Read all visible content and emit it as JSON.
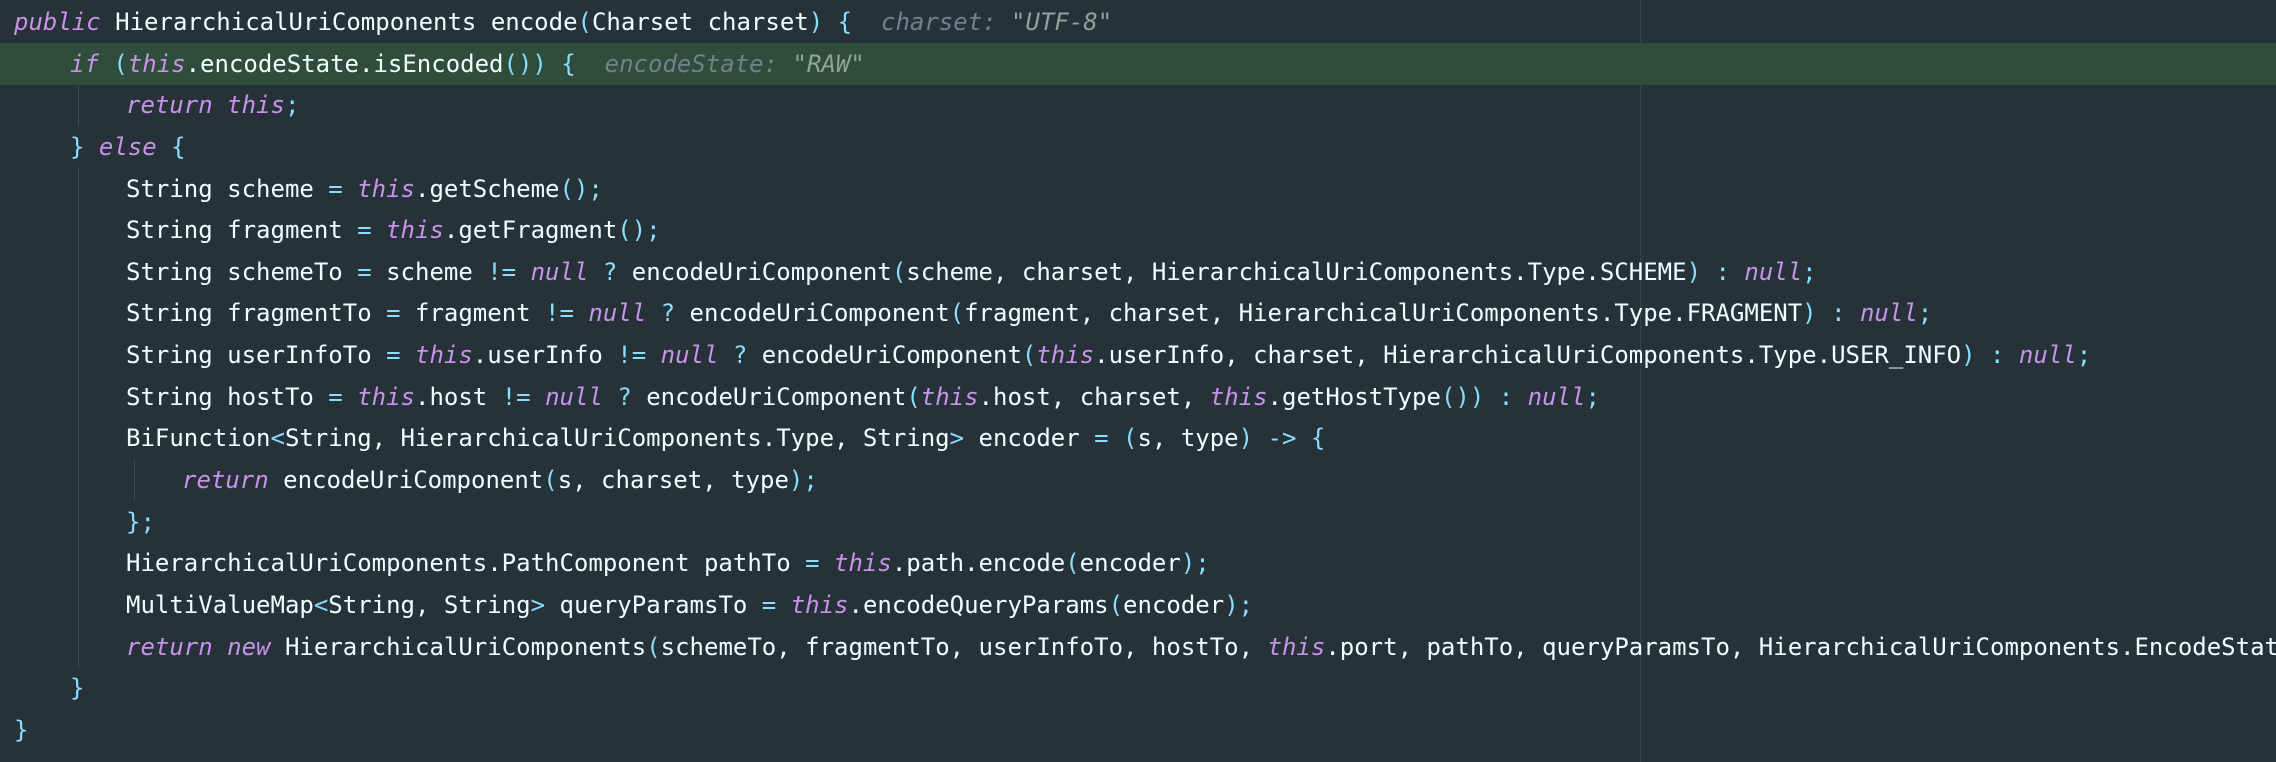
{
  "editor": {
    "theme": "material-darker",
    "colors": {
      "background": "#263238",
      "highlight_line": "#2f4d3a",
      "keyword": "#C792EA",
      "punctuation": "#89DDFF",
      "text": "#EEFFFF",
      "inlay_hint": "#6f828c"
    },
    "lines": [
      {
        "tokens": [
          {
            "t": "public",
            "c": "kw"
          },
          {
            "t": " HierarchicalUriComponents encode",
            "c": "plain"
          },
          {
            "t": "(",
            "c": "pu"
          },
          {
            "t": "Charset charset",
            "c": "plain"
          },
          {
            "t": ")",
            "c": "pu"
          },
          {
            "t": " ",
            "c": "plain"
          },
          {
            "t": "{",
            "c": "pu"
          },
          {
            "t": "  charset: ",
            "c": "hint"
          },
          {
            "t": "\"UTF-8\"",
            "c": "hint-str"
          }
        ]
      },
      {
        "tokens": [
          {
            "t": "if",
            "c": "kw"
          },
          {
            "t": " ",
            "c": "plain"
          },
          {
            "t": "(",
            "c": "pu"
          },
          {
            "t": "this",
            "c": "kw"
          },
          {
            "t": ".encodeState.isEncoded",
            "c": "plain"
          },
          {
            "t": "()) {",
            "c": "pu"
          },
          {
            "t": "  encodeState: ",
            "c": "hint"
          },
          {
            "t": "\"RAW\"",
            "c": "hint-str"
          }
        ]
      },
      {
        "tokens": [
          {
            "t": "return",
            "c": "kw"
          },
          {
            "t": " ",
            "c": "plain"
          },
          {
            "t": "this",
            "c": "kw"
          },
          {
            "t": ";",
            "c": "pu"
          }
        ]
      },
      {
        "tokens": [
          {
            "t": "}",
            "c": "pu"
          },
          {
            "t": " ",
            "c": "plain"
          },
          {
            "t": "else",
            "c": "kw"
          },
          {
            "t": " ",
            "c": "plain"
          },
          {
            "t": "{",
            "c": "pu"
          }
        ]
      },
      {
        "tokens": [
          {
            "t": "String scheme ",
            "c": "plain"
          },
          {
            "t": "=",
            "c": "pu"
          },
          {
            "t": " ",
            "c": "plain"
          },
          {
            "t": "this",
            "c": "kw"
          },
          {
            "t": ".getScheme",
            "c": "plain"
          },
          {
            "t": "();",
            "c": "pu"
          }
        ]
      },
      {
        "tokens": [
          {
            "t": "String fragment ",
            "c": "plain"
          },
          {
            "t": "=",
            "c": "pu"
          },
          {
            "t": " ",
            "c": "plain"
          },
          {
            "t": "this",
            "c": "kw"
          },
          {
            "t": ".getFragment",
            "c": "plain"
          },
          {
            "t": "();",
            "c": "pu"
          }
        ]
      },
      {
        "tokens": [
          {
            "t": "String schemeTo ",
            "c": "plain"
          },
          {
            "t": "=",
            "c": "pu"
          },
          {
            "t": " scheme ",
            "c": "plain"
          },
          {
            "t": "!=",
            "c": "pu"
          },
          {
            "t": " ",
            "c": "plain"
          },
          {
            "t": "null",
            "c": "kw"
          },
          {
            "t": " ",
            "c": "plain"
          },
          {
            "t": "?",
            "c": "pu"
          },
          {
            "t": " encodeUriComponent",
            "c": "plain"
          },
          {
            "t": "(",
            "c": "pu"
          },
          {
            "t": "scheme, charset, HierarchicalUriComponents.Type.SCHEME",
            "c": "plain"
          },
          {
            "t": ")",
            "c": "pu"
          },
          {
            "t": " ",
            "c": "plain"
          },
          {
            "t": ":",
            "c": "pu"
          },
          {
            "t": " ",
            "c": "plain"
          },
          {
            "t": "null",
            "c": "kw"
          },
          {
            "t": ";",
            "c": "pu"
          }
        ]
      },
      {
        "tokens": [
          {
            "t": "String fragmentTo ",
            "c": "plain"
          },
          {
            "t": "=",
            "c": "pu"
          },
          {
            "t": " fragment ",
            "c": "plain"
          },
          {
            "t": "!=",
            "c": "pu"
          },
          {
            "t": " ",
            "c": "plain"
          },
          {
            "t": "null",
            "c": "kw"
          },
          {
            "t": " ",
            "c": "plain"
          },
          {
            "t": "?",
            "c": "pu"
          },
          {
            "t": " encodeUriComponent",
            "c": "plain"
          },
          {
            "t": "(",
            "c": "pu"
          },
          {
            "t": "fragment, charset, HierarchicalUriComponents.Type.FRAGMENT",
            "c": "plain"
          },
          {
            "t": ")",
            "c": "pu"
          },
          {
            "t": " ",
            "c": "plain"
          },
          {
            "t": ":",
            "c": "pu"
          },
          {
            "t": " ",
            "c": "plain"
          },
          {
            "t": "null",
            "c": "kw"
          },
          {
            "t": ";",
            "c": "pu"
          }
        ]
      },
      {
        "tokens": [
          {
            "t": "String userInfoTo ",
            "c": "plain"
          },
          {
            "t": "=",
            "c": "pu"
          },
          {
            "t": " ",
            "c": "plain"
          },
          {
            "t": "this",
            "c": "kw"
          },
          {
            "t": ".userInfo ",
            "c": "plain"
          },
          {
            "t": "!=",
            "c": "pu"
          },
          {
            "t": " ",
            "c": "plain"
          },
          {
            "t": "null",
            "c": "kw"
          },
          {
            "t": " ",
            "c": "plain"
          },
          {
            "t": "?",
            "c": "pu"
          },
          {
            "t": " encodeUriComponent",
            "c": "plain"
          },
          {
            "t": "(",
            "c": "pu"
          },
          {
            "t": "this",
            "c": "kw"
          },
          {
            "t": ".userInfo, charset, HierarchicalUriComponents.Type.USER_INFO",
            "c": "plain"
          },
          {
            "t": ")",
            "c": "pu"
          },
          {
            "t": " ",
            "c": "plain"
          },
          {
            "t": ":",
            "c": "pu"
          },
          {
            "t": " ",
            "c": "plain"
          },
          {
            "t": "null",
            "c": "kw"
          },
          {
            "t": ";",
            "c": "pu"
          }
        ]
      },
      {
        "tokens": [
          {
            "t": "String hostTo ",
            "c": "plain"
          },
          {
            "t": "=",
            "c": "pu"
          },
          {
            "t": " ",
            "c": "plain"
          },
          {
            "t": "this",
            "c": "kw"
          },
          {
            "t": ".host ",
            "c": "plain"
          },
          {
            "t": "!=",
            "c": "pu"
          },
          {
            "t": " ",
            "c": "plain"
          },
          {
            "t": "null",
            "c": "kw"
          },
          {
            "t": " ",
            "c": "plain"
          },
          {
            "t": "?",
            "c": "pu"
          },
          {
            "t": " encodeUriComponent",
            "c": "plain"
          },
          {
            "t": "(",
            "c": "pu"
          },
          {
            "t": "this",
            "c": "kw"
          },
          {
            "t": ".host, charset, ",
            "c": "plain"
          },
          {
            "t": "this",
            "c": "kw"
          },
          {
            "t": ".getHostType",
            "c": "plain"
          },
          {
            "t": "())",
            "c": "pu"
          },
          {
            "t": " ",
            "c": "plain"
          },
          {
            "t": ":",
            "c": "pu"
          },
          {
            "t": " ",
            "c": "plain"
          },
          {
            "t": "null",
            "c": "kw"
          },
          {
            "t": ";",
            "c": "pu"
          }
        ]
      },
      {
        "tokens": [
          {
            "t": "BiFunction",
            "c": "plain"
          },
          {
            "t": "<",
            "c": "pu"
          },
          {
            "t": "String, HierarchicalUriComponents.Type, String",
            "c": "plain"
          },
          {
            "t": ">",
            "c": "pu"
          },
          {
            "t": " encoder ",
            "c": "plain"
          },
          {
            "t": "=",
            "c": "pu"
          },
          {
            "t": " ",
            "c": "plain"
          },
          {
            "t": "(",
            "c": "pu"
          },
          {
            "t": "s, type",
            "c": "plain"
          },
          {
            "t": ")",
            "c": "pu"
          },
          {
            "t": " ",
            "c": "plain"
          },
          {
            "t": "->",
            "c": "pu"
          },
          {
            "t": " ",
            "c": "plain"
          },
          {
            "t": "{",
            "c": "pu"
          }
        ]
      },
      {
        "tokens": [
          {
            "t": "return",
            "c": "kw"
          },
          {
            "t": " encodeUriComponent",
            "c": "plain"
          },
          {
            "t": "(",
            "c": "pu"
          },
          {
            "t": "s, charset, type",
            "c": "plain"
          },
          {
            "t": ");",
            "c": "pu"
          }
        ]
      },
      {
        "tokens": [
          {
            "t": "};",
            "c": "pu"
          }
        ]
      },
      {
        "tokens": [
          {
            "t": "HierarchicalUriComponents.PathComponent pathTo ",
            "c": "plain"
          },
          {
            "t": "=",
            "c": "pu"
          },
          {
            "t": " ",
            "c": "plain"
          },
          {
            "t": "this",
            "c": "kw"
          },
          {
            "t": ".path.encode",
            "c": "plain"
          },
          {
            "t": "(",
            "c": "pu"
          },
          {
            "t": "encoder",
            "c": "plain"
          },
          {
            "t": ");",
            "c": "pu"
          }
        ]
      },
      {
        "tokens": [
          {
            "t": "MultiValueMap",
            "c": "plain"
          },
          {
            "t": "<",
            "c": "pu"
          },
          {
            "t": "String, String",
            "c": "plain"
          },
          {
            "t": ">",
            "c": "pu"
          },
          {
            "t": " queryParamsTo ",
            "c": "plain"
          },
          {
            "t": "=",
            "c": "pu"
          },
          {
            "t": " ",
            "c": "plain"
          },
          {
            "t": "this",
            "c": "kw"
          },
          {
            "t": ".encodeQueryParams",
            "c": "plain"
          },
          {
            "t": "(",
            "c": "pu"
          },
          {
            "t": "encoder",
            "c": "plain"
          },
          {
            "t": ");",
            "c": "pu"
          }
        ]
      },
      {
        "tokens": [
          {
            "t": "return",
            "c": "kw"
          },
          {
            "t": " ",
            "c": "plain"
          },
          {
            "t": "new",
            "c": "kw"
          },
          {
            "t": " HierarchicalUriComponents",
            "c": "plain"
          },
          {
            "t": "(",
            "c": "pu"
          },
          {
            "t": "schemeTo, fragmentTo, userInfoTo, hostTo, ",
            "c": "plain"
          },
          {
            "t": "this",
            "c": "kw"
          },
          {
            "t": ".port, pathTo, queryParamsTo, HierarchicalUriComponents.EncodeState.FULLY_ENCODED",
            "c": "plain"
          },
          {
            "t": ");",
            "c": "pu"
          }
        ]
      },
      {
        "tokens": [
          {
            "t": "}",
            "c": "pu"
          }
        ]
      },
      {
        "tokens": [
          {
            "t": "}",
            "c": "pu"
          }
        ]
      }
    ]
  }
}
